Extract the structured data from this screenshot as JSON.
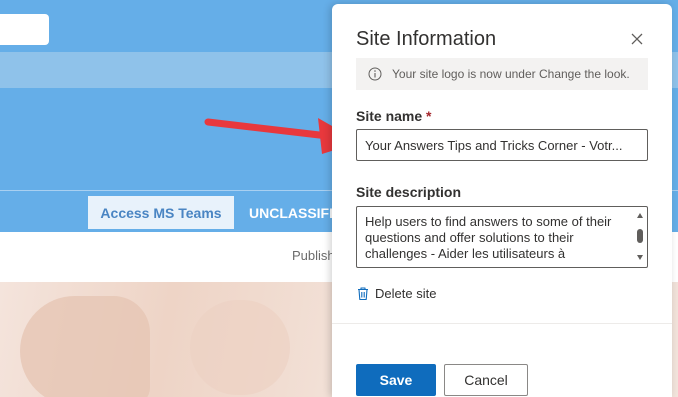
{
  "background_page": {
    "teams_button_label": "Access MS Teams",
    "classification_label": "UNCLASSIFIED",
    "published_text": "Publish"
  },
  "panel": {
    "title": "Site Information",
    "info_message": "Your site logo is now under Change the look.",
    "site_name": {
      "label": "Site name",
      "required_marker": "*",
      "value": "Your Answers Tips and Tricks Corner - Votr..."
    },
    "site_description": {
      "label": "Site description",
      "value": "Help users to find answers to some of their questions and offer solutions to their challenges - Aider les utilisateurs à"
    },
    "delete_label": "Delete site",
    "save_label": "Save",
    "cancel_label": "Cancel"
  },
  "colors": {
    "header_blue": "#65aee8",
    "primary_button": "#0f6cbd",
    "annotation_arrow": "#e8383d",
    "required_marker": "#a4262c"
  },
  "icons": {
    "close": "close-icon",
    "info": "info-icon",
    "delete": "trash-icon"
  }
}
